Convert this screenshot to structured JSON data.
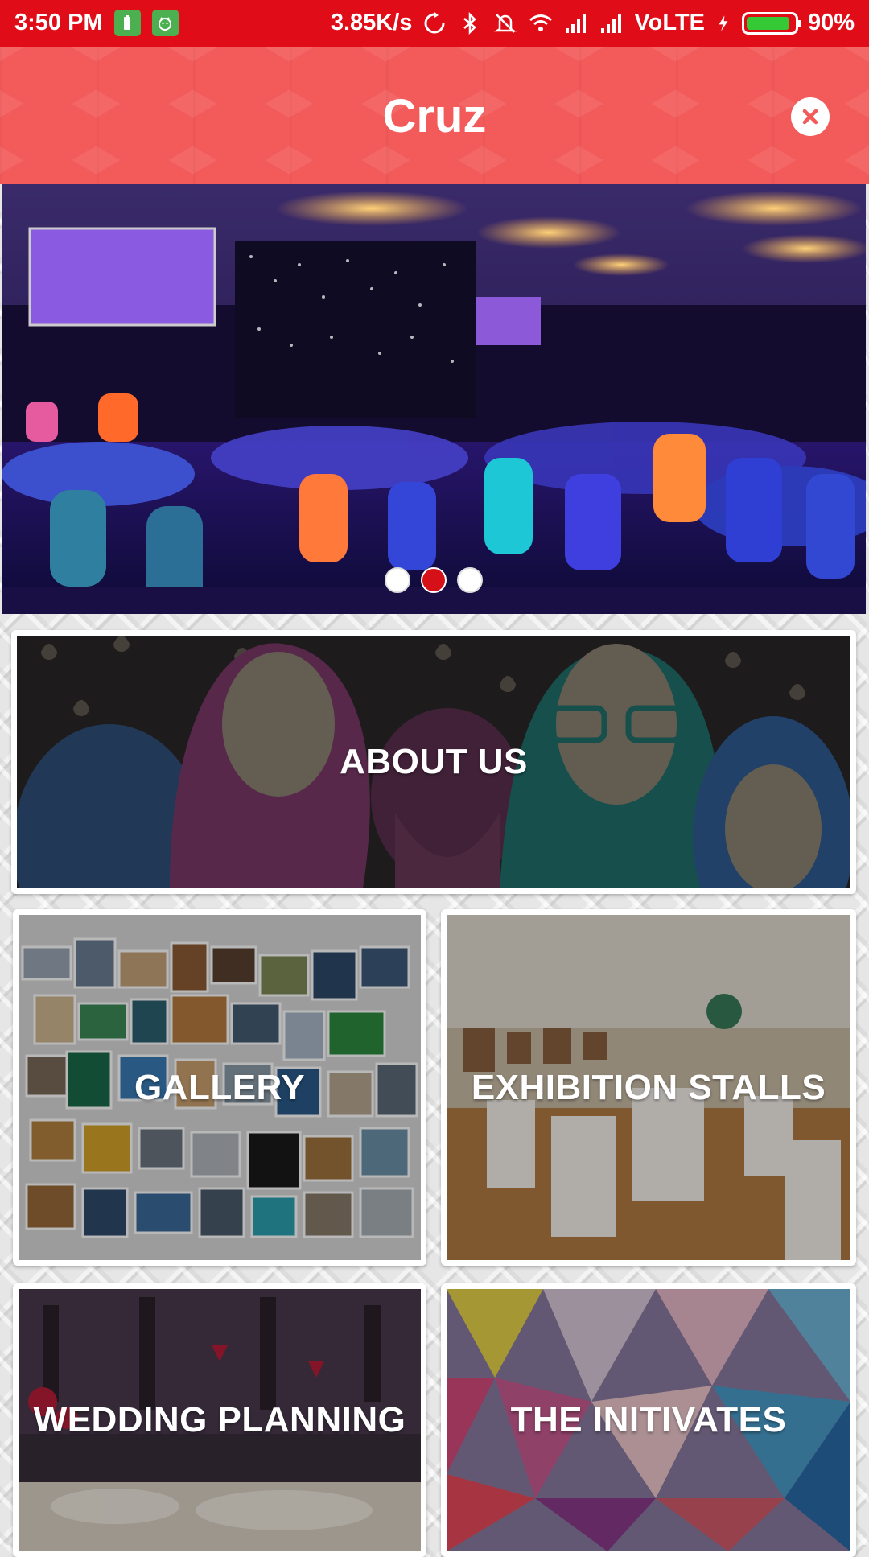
{
  "status_bar": {
    "time": "3:50 PM",
    "net_speed": "3.85K/s",
    "network_label": "VoLTE",
    "battery_percent": "90%",
    "battery_level": 0.9
  },
  "header": {
    "title": "Cruz",
    "close_icon": "close-circle-icon"
  },
  "carousel": {
    "slide_count": 3,
    "active_index": 1
  },
  "tiles": {
    "about": "ABOUT US",
    "gallery": "GALLERY",
    "exhibition": "EXHIBITION STALLS",
    "wedding": "WEDDING PLANNING",
    "initiates": "THE INITIVATES"
  },
  "colors": {
    "status_bar": "#e00c17",
    "header": "#f35a5a",
    "active_dot": "#d51018"
  }
}
